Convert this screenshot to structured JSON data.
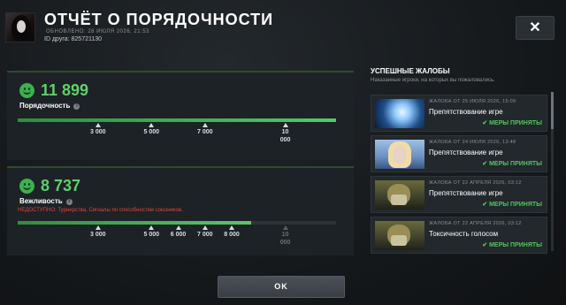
{
  "header": {
    "title": "ОТЧЁТ О ПОРЯДОЧНОСТИ",
    "updated": "ОБНОВЛЕНО: 28 ИЮЛЯ 2026, 21:53",
    "friend_id": "ID друга: 825721130",
    "close_label": "✕"
  },
  "conduct": {
    "score": "11 899",
    "label": "Порядочность",
    "progress_value": 11899,
    "scale_max": 11899,
    "ticks": [
      {
        "label": "3 000",
        "value": 3000
      },
      {
        "label": "5 000",
        "value": 5000
      },
      {
        "label": "7 000",
        "value": 7000
      },
      {
        "label": "10\n000",
        "value": 10000
      }
    ]
  },
  "courtesy": {
    "score": "8 737",
    "label": "Вежливость",
    "unavailable_text": "НЕДОСТУПНО: Турнирства, Сигналы по способностям союзников.",
    "progress_value": 8737,
    "scale_max": 11899,
    "ticks": [
      {
        "label": "3 000",
        "value": 3000,
        "dim": false
      },
      {
        "label": "5 000",
        "value": 5000,
        "dim": false
      },
      {
        "label": "6 000",
        "value": 6000,
        "dim": false
      },
      {
        "label": "7 000",
        "value": 7000,
        "dim": false
      },
      {
        "label": "8 000",
        "value": 8000,
        "dim": false
      },
      {
        "label": "10\n000",
        "value": 10000,
        "dim": true
      }
    ]
  },
  "reports": {
    "title": "УСПЕШНЫЕ ЖАЛОБЫ",
    "subtitle": "Наказанные игроки, на которых вы пожаловались.",
    "items": [
      {
        "date": "ЖАЛОБА ОТ 25 ИЮЛЯ 2026, 15:09",
        "reason": "Препятствование игре",
        "status": "✔ МЕРЫ ПРИНЯТЫ",
        "thumb": "crystal"
      },
      {
        "date": "ЖАЛОБА ОТ 24 ИЮЛЯ 2026, 13:48",
        "reason": "Препятствование игре",
        "status": "✔ МЕРЫ ПРИНЯТЫ",
        "thumb": "lady"
      },
      {
        "date": "ЖАЛОБА ОТ 22 АПРЕЛЯ 2026, 03:12",
        "reason": "Препятствование игре",
        "status": "✔ МЕРЫ ПРИНЯТЫ",
        "thumb": "tide"
      },
      {
        "date": "ЖАЛОБА ОТ 22 АПРЕЛЯ 2026, 03:12",
        "reason": "Токсичность голосом",
        "status": "✔ МЕРЫ ПРИНЯТЫ",
        "thumb": "tide"
      }
    ]
  },
  "footer": {
    "ok_label": "OK"
  },
  "colors": {
    "accent_green": "#5fd06b",
    "warning_red": "#e0453c",
    "status_green": "#52c45e"
  }
}
